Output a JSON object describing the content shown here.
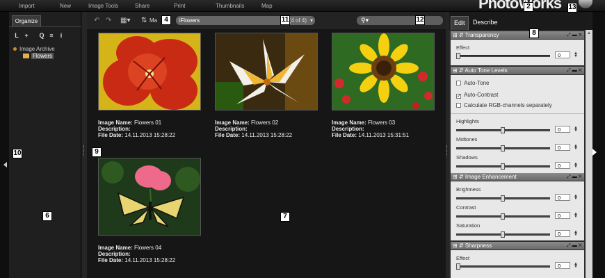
{
  "menu": {
    "items": [
      "Import",
      "New",
      "Image Tools",
      "Share",
      "Print",
      "Thumbnails",
      "Map"
    ],
    "brand": "PhotoWorks"
  },
  "callouts": [
    "2",
    "4",
    "6",
    "7",
    "8",
    "9",
    "10",
    "11",
    "12",
    "13"
  ],
  "left_panel": {
    "tab": "Organize",
    "tools": [
      "L",
      "+",
      "Q",
      "≡",
      "i"
    ],
    "tree": {
      "root": "Image Archive",
      "child": "Flowers"
    }
  },
  "toolbar": {
    "view_label": "Ma",
    "path": "\\Flowers",
    "path_count": "(4 of 4)"
  },
  "thumbnails": [
    {
      "name_label": "Image Name:",
      "name": "Flowers 01",
      "desc_label": "Description:",
      "date_label": "File Date:",
      "date": "14.11.2013 15:28:22"
    },
    {
      "name_label": "Image Name:",
      "name": "Flowers 02",
      "desc_label": "Description:",
      "date_label": "File Date:",
      "date": "14.11.2013 15:28:22"
    },
    {
      "name_label": "Image Name:",
      "name": "Flowers 03",
      "desc_label": "Description:",
      "date_label": "File Date:",
      "date": "14.11.2013 15:31:51"
    },
    {
      "name_label": "Image Name:",
      "name": "Flowers 04",
      "desc_label": "Description:",
      "date_label": "File Date:",
      "date": "14.11.2013 15:28:22"
    }
  ],
  "right_panel": {
    "tabs": [
      "Edit",
      "Describe"
    ],
    "sections": {
      "transparency": {
        "title": "Transparency",
        "effect": "Effect",
        "effect_value": "0"
      },
      "auto_tone": {
        "title": "Auto Tone Levels",
        "auto_tone": "Auto-Tone",
        "auto_contrast": "Auto-Contrast",
        "rgb": "Calculate RGB-channels separately",
        "highlights": "Highlights",
        "midtones": "Midtones",
        "shadows": "Shadows",
        "highlights_value": "0",
        "midtones_value": "0",
        "shadows_value": "0"
      },
      "enhancement": {
        "title": "Image Enhancement",
        "brightness": "Brightness",
        "contrast": "Contrast",
        "saturation": "Saturation",
        "brightness_value": "0",
        "contrast_value": "0",
        "saturation_value": "0"
      },
      "sharpness": {
        "title": "Sharpness",
        "effect": "Effect",
        "effect_value": "0"
      }
    }
  },
  "colors": {
    "accent_folder": "#e0b04a",
    "root_dot": "#d18a2a",
    "header_gray": "#7a7a7a"
  }
}
